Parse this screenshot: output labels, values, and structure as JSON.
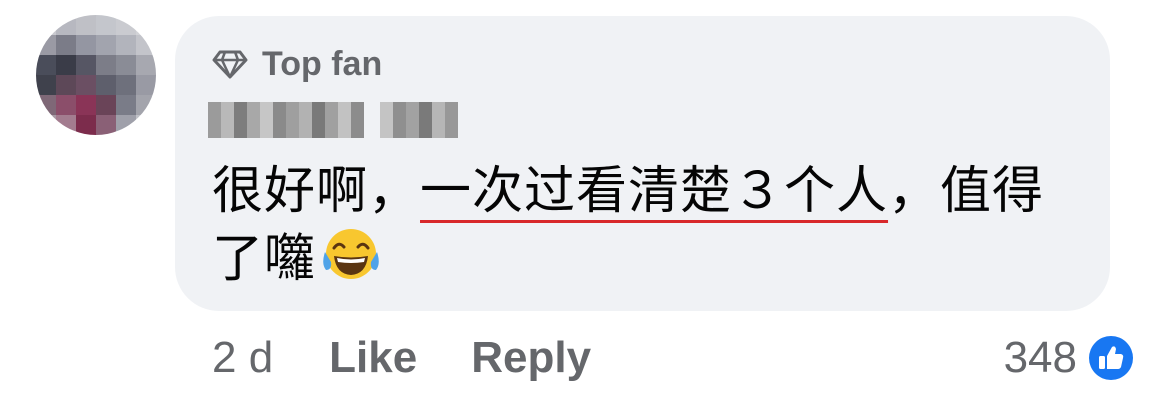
{
  "comment": {
    "badge_label": "Top fan",
    "badge_icon": "diamond-icon",
    "text_before": "很好啊，",
    "text_highlight": "一次过看清楚３个人",
    "text_after": "，值得了囖",
    "emoji": "tears-of-joy-emoji",
    "highlight_color": "#d8282b"
  },
  "actions": {
    "time": "2 d",
    "like_label": "Like",
    "reply_label": "Reply"
  },
  "reactions": {
    "count": "348",
    "icon": "like-thumb-icon",
    "color": "#1877f2"
  },
  "colors": {
    "bubble": "#f0f2f5",
    "secondary_text": "#65676b",
    "primary_text": "#050505"
  }
}
